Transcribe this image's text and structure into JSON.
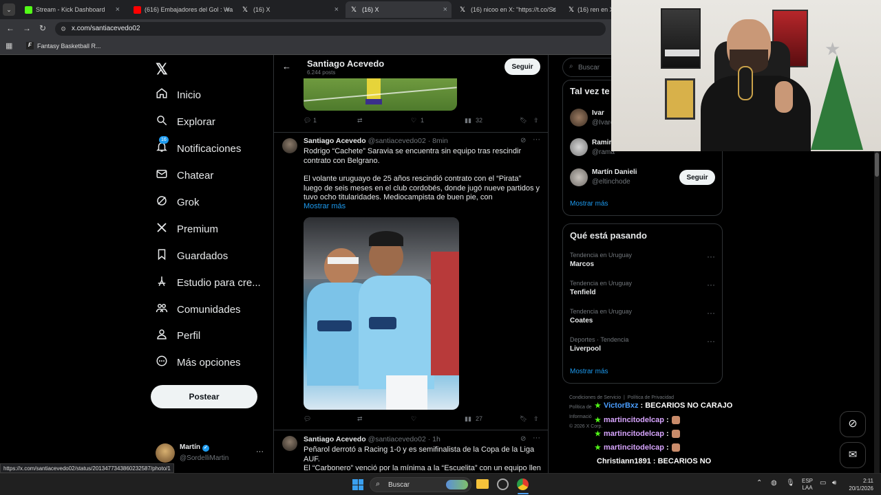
{
  "tabs": [
    {
      "title": "Stream - Kick Dashboard",
      "favicon_color": "#53fc18"
    },
    {
      "title": "(616) Embajadores del Gol : Wa",
      "favicon_color": "#ff0000"
    },
    {
      "title": "(16) X",
      "favicon_color": "#ffffff"
    },
    {
      "title": "(16) X",
      "favicon_color": "#ffffff"
    },
    {
      "title": "(16) nicoo en X: \"https://t.co/Sc",
      "favicon_color": "#ffffff"
    },
    {
      "title": "(16) ren en X:",
      "favicon_color": "#ffffff"
    }
  ],
  "address": {
    "url": "x.com/santiacevedo02"
  },
  "bookmarks": [
    {
      "label": "Fantasy Basketball R..."
    }
  ],
  "sidebar": {
    "items": [
      {
        "label": "Inicio",
        "icon": "home-icon"
      },
      {
        "label": "Explorar",
        "icon": "search-icon"
      },
      {
        "label": "Notificaciones",
        "icon": "bell-icon",
        "badge": "16"
      },
      {
        "label": "Chatear",
        "icon": "mail-icon"
      },
      {
        "label": "Grok",
        "icon": "grok-icon"
      },
      {
        "label": "Premium",
        "icon": "x-logo-icon"
      },
      {
        "label": "Guardados",
        "icon": "bookmark-icon"
      },
      {
        "label": "Estudio para cre...",
        "icon": "studio-icon"
      },
      {
        "label": "Comunidades",
        "icon": "communities-icon"
      },
      {
        "label": "Perfil",
        "icon": "person-icon"
      },
      {
        "label": "Más opciones",
        "icon": "more-icon"
      }
    ],
    "post_button": "Postear",
    "account": {
      "name": "Martín",
      "handle": "@SordelliMartin"
    }
  },
  "profile_header": {
    "name": "Santiago Acevedo",
    "posts": "6.244 posts",
    "follow_label": "Seguir"
  },
  "tweets": [
    {
      "actions": {
        "replies": "1",
        "retweets": "",
        "likes": "1",
        "views": "32"
      }
    },
    {
      "author": "Santiago Acevedo",
      "handle": "@santiacevedo02",
      "time": "· 8min",
      "text1": "Rodrigo “Cachete” Saravia se encuentra sin equipo tras rescindir contrato con Belgrano.",
      "text2": "El volante uruguayo de 25 años rescindió contrato con el “Pirata” luego de seis meses en el club cordobés, donde jugó nueve partidos y tuvo ocho titularidades. Mediocampista de buen pie, con",
      "show_more": "Mostrar más",
      "actions": {
        "replies": "",
        "retweets": "",
        "likes": "",
        "views": "27"
      }
    },
    {
      "author": "Santiago Acevedo",
      "handle": "@santiacevedo02",
      "time": "· 1h",
      "text1": "Peñarol derrotó a Racing 1-0 y es semifinalista de la Copa de la Liga AUF.",
      "text2": "El “Carbonero” venció por la mínima a la “Escuelita” con un equipo lleno de"
    }
  ],
  "right": {
    "search_placeholder": "Buscar",
    "who_to_follow": {
      "title": "Tal vez te",
      "users": [
        {
          "name": "Ivar",
          "handle": "@Ivaro"
        },
        {
          "name": "Ramir",
          "handle": "@rama"
        },
        {
          "name": "Martín Danieli",
          "handle": "@eltinchode",
          "follow": "Seguir"
        }
      ],
      "show_more": "Mostrar más"
    },
    "trends": {
      "title": "Qué está pasando",
      "items": [
        {
          "context": "Tendencia en Uruguay",
          "name": "Marcos"
        },
        {
          "context": "Tendencia en Uruguay",
          "name": "Tenfield"
        },
        {
          "context": "Tendencia en Uruguay",
          "name": "Coates"
        },
        {
          "context": "Deportes · Tendencia",
          "name": "Liverpool"
        }
      ],
      "show_more": "Mostrar más"
    },
    "footer": {
      "line1a": "Condiciones de Servicio",
      "line1b": "Política de Privacidad",
      "line2": "Política de",
      "line3": "Informació",
      "line4": "© 2026 X Corp."
    }
  },
  "chat": [
    {
      "user": "VictorBxz",
      "msg": ": BECARIOS NO CARAJO",
      "color": "#4a9eff"
    },
    {
      "user": "martincitodelcap",
      "msg": ":",
      "color": "#d8a5ff",
      "emote": true
    },
    {
      "user": "martincitodelcap",
      "msg": ":",
      "color": "#d8a5ff",
      "emote": true
    },
    {
      "user": "martincitodelcap",
      "msg": ":",
      "color": "#d8a5ff",
      "emote": true
    },
    {
      "user": "Christiann1891",
      "msg": ": BECARIOS NO",
      "color": "#ffffff"
    }
  ],
  "status_url": "https://x.com/santiacevedo02/status/2013477343860232587/photo/1",
  "taskbar": {
    "search_placeholder": "Buscar",
    "lang1": "ESP",
    "lang2": "LAA",
    "time": "2:11",
    "date": "20/1/2026"
  }
}
